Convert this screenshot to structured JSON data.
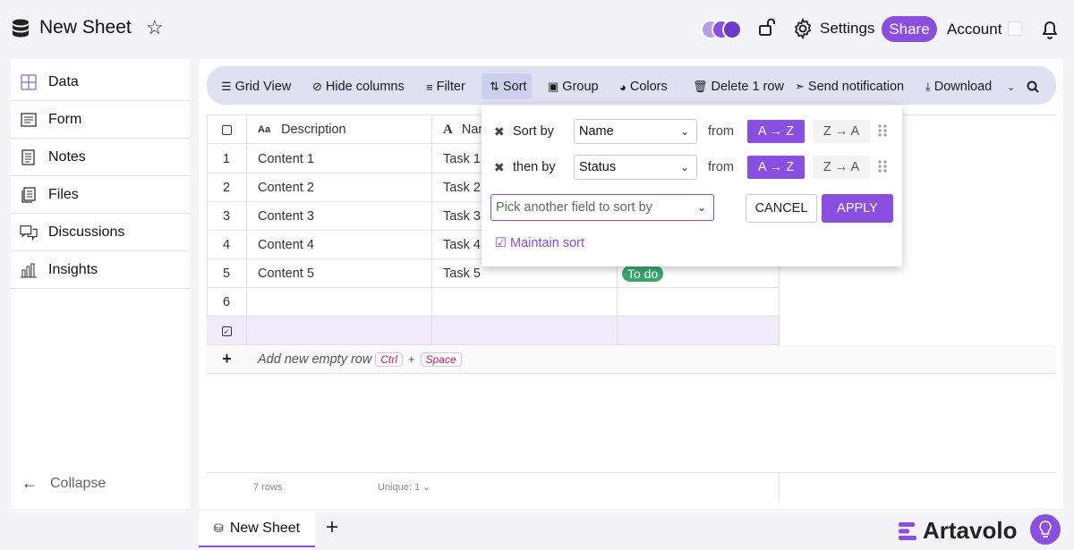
{
  "header": {
    "title": "New Sheet",
    "settings_label": "Settings",
    "share_label": "Share",
    "account_label": "Account"
  },
  "sidebar": {
    "items": [
      {
        "label": "Data",
        "icon": "grid-icon"
      },
      {
        "label": "Form",
        "icon": "form-icon"
      },
      {
        "label": "Notes",
        "icon": "notes-icon"
      },
      {
        "label": "Files",
        "icon": "files-icon"
      },
      {
        "label": "Discussions",
        "icon": "discussions-icon"
      },
      {
        "label": "Insights",
        "icon": "insights-icon"
      }
    ],
    "collapse_label": "Collapse"
  },
  "toolbar": {
    "grid_view": "Grid View",
    "hide_columns": "Hide columns",
    "filter": "Filter",
    "sort": "Sort",
    "group": "Group",
    "colors": "Colors",
    "delete_row": "Delete 1 row",
    "send_notification": "Send notification",
    "download": "Download"
  },
  "grid": {
    "columns": [
      "Description",
      "Name",
      ""
    ],
    "rows": [
      {
        "num": "1",
        "description": "Content 1",
        "name": "Task 1",
        "status": ""
      },
      {
        "num": "2",
        "description": "Content 2",
        "name": "Task 2",
        "status": ""
      },
      {
        "num": "3",
        "description": "Content 3",
        "name": "Task 3",
        "status": ""
      },
      {
        "num": "4",
        "description": "Content 4",
        "name": "Task 4",
        "status": ""
      },
      {
        "num": "5",
        "description": "Content 5",
        "name": "Task 5",
        "status": "To do"
      },
      {
        "num": "6",
        "description": "",
        "name": "",
        "status": ""
      }
    ],
    "add_row_label": "Add new empty row",
    "shortcut_key1": "Ctrl",
    "shortcut_plus": "+",
    "shortcut_key2": "Space",
    "footer_rows": "7 rows",
    "footer_unique": "Unique: 1"
  },
  "sort_popup": {
    "rules": [
      {
        "label": "Sort by",
        "field": "Name",
        "from": "from",
        "asc": "A → Z",
        "desc": "Z → A"
      },
      {
        "label": "then by",
        "field": "Status",
        "from": "from",
        "asc": "A → Z",
        "desc": "Z → A"
      }
    ],
    "pick_placeholder": "Pick another field to sort by",
    "cancel_label": "CANCEL",
    "apply_label": "APPLY",
    "maintain_label": "Maintain sort"
  },
  "tabs": {
    "active": "New Sheet",
    "add": "+"
  },
  "brand": {
    "name": "Artavolo"
  },
  "colors": {
    "accent": "#8a4ee0",
    "status_todo": "#3aa76d",
    "toolbar_bg": "#dfe0f2"
  }
}
